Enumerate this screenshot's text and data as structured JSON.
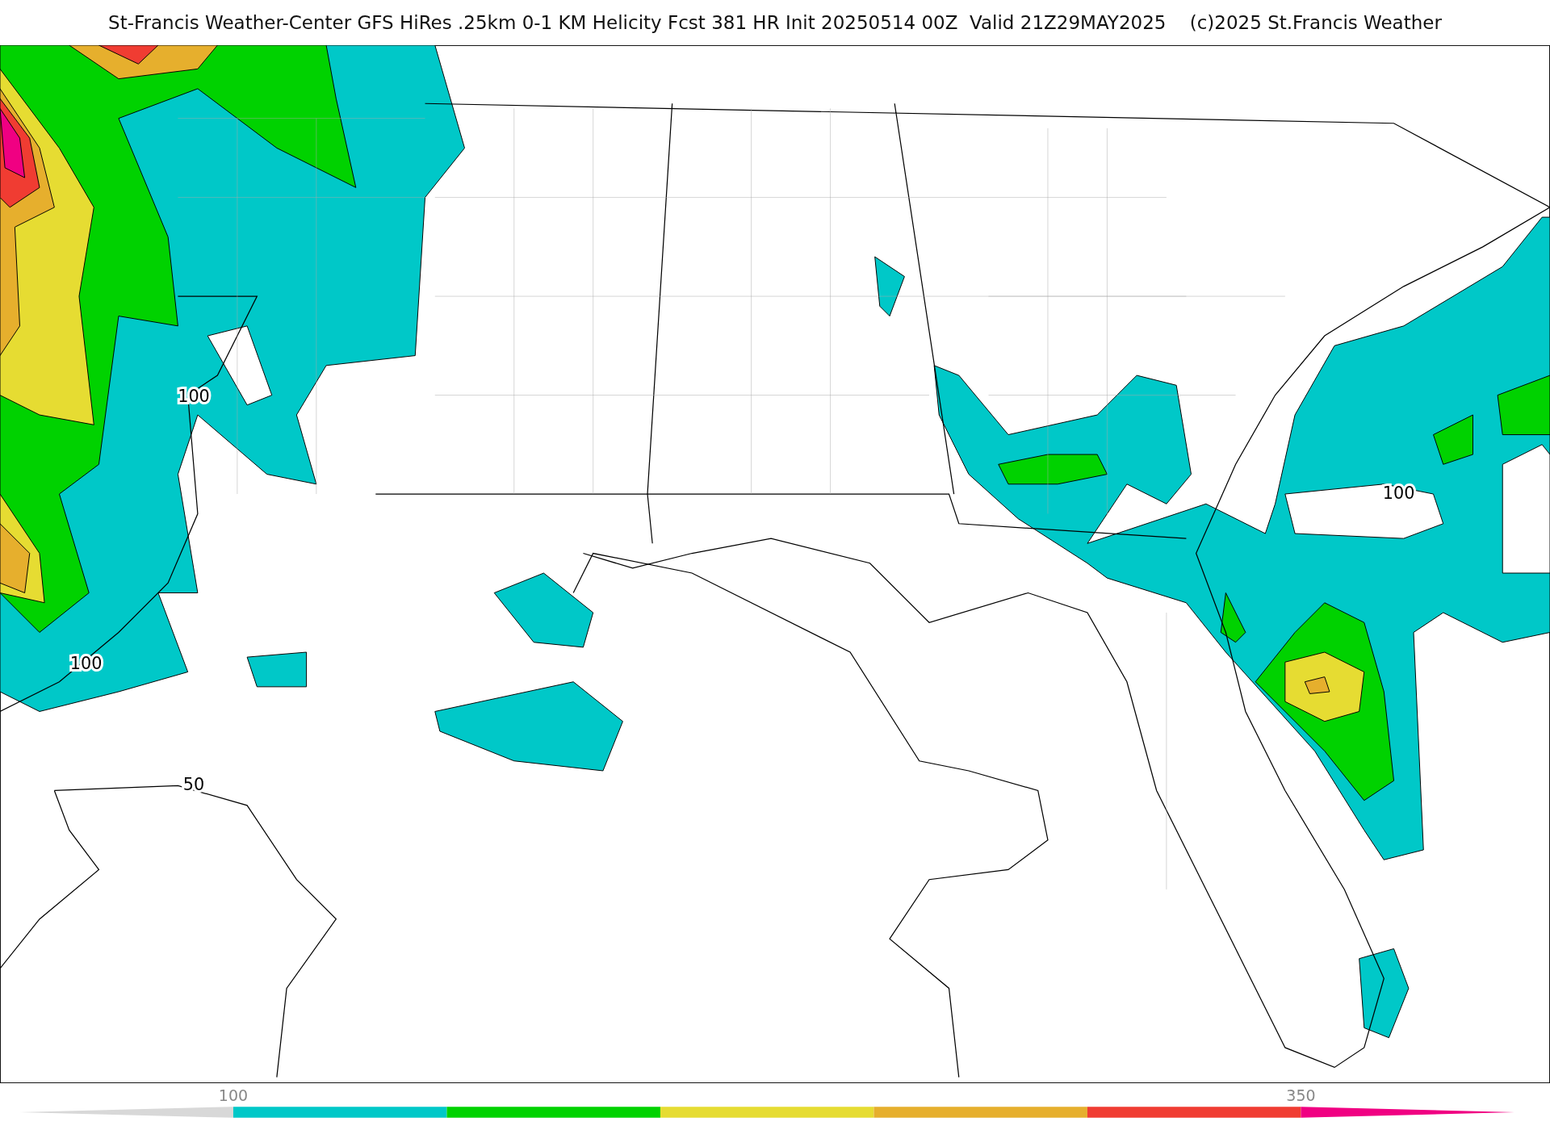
{
  "title": "St-Francis Weather-Center GFS HiRes .25km 0-1 KM Helicity Fcst 381 HR Init 20250514 00Z  Valid 21Z29MAY2025    (c)2025 St.Francis Weather",
  "contour_labels": [
    "100",
    "100",
    "50",
    "100"
  ],
  "colorbar": {
    "ticks": [
      "100",
      "350"
    ],
    "segments": [
      {
        "kind": "wedge-left",
        "color": "#d8d8d8"
      },
      {
        "kind": "band",
        "color": "#00c8c8"
      },
      {
        "kind": "band",
        "color": "#00d200"
      },
      {
        "kind": "band",
        "color": "#e6dc32"
      },
      {
        "kind": "band",
        "color": "#e6af2d"
      },
      {
        "kind": "band",
        "color": "#f03c32"
      },
      {
        "kind": "wedge-right",
        "color": "#f00082"
      }
    ]
  }
}
